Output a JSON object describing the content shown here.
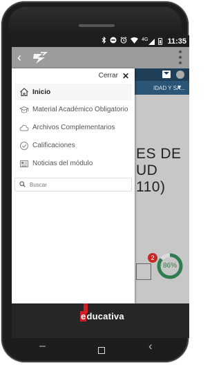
{
  "status_bar": {
    "network": "4G",
    "time": "11:35",
    "icons": [
      "bluetooth-icon",
      "do-not-disturb-icon",
      "alarm-icon",
      "wifi-icon",
      "signal-icon",
      "battery-icon"
    ]
  },
  "app_bar": {
    "back_icon": "chevron-left-icon",
    "logo_icon": "educativa-logo-icon",
    "menu_icon": "kebab-menu-icon"
  },
  "background_page": {
    "nav_text": "IDAD Y SA...",
    "title_lines": [
      "ES DE",
      "UD",
      "110)"
    ],
    "notification_count": "2",
    "progress_label": "86%",
    "progress_value": 0.86,
    "accent": "#2e7d4f"
  },
  "drawer": {
    "close_label": "Cerrar",
    "items": [
      {
        "label": "Inicio",
        "icon": "home-icon",
        "active": true
      },
      {
        "label": "Material Académico Obligatorio",
        "icon": "graduation-cap-icon",
        "active": false
      },
      {
        "label": "Archivos Complementarios",
        "icon": "cloud-icon",
        "active": false
      },
      {
        "label": "Calificaciones",
        "icon": "check-circle-icon",
        "active": false
      },
      {
        "label": "Noticias del módulo",
        "icon": "newspaper-icon",
        "active": false
      }
    ],
    "search_placeholder": "Buscar"
  },
  "brand": {
    "first_letter": "e",
    "rest": "ducativa",
    "accent": "#d21f26"
  },
  "nav_bar": {
    "icons": [
      "home-nav-icon",
      "recent-apps-icon",
      "back-nav-icon"
    ]
  }
}
